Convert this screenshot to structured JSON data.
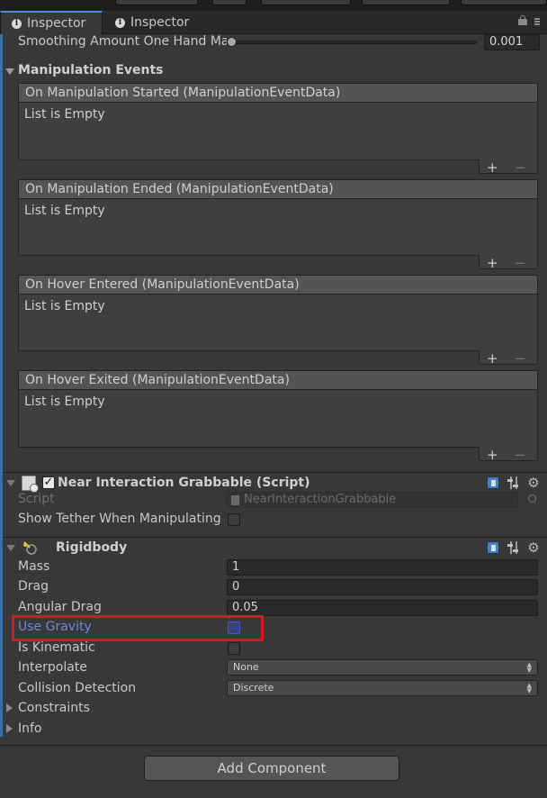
{
  "tabs": [
    {
      "label": "Inspector",
      "icon": "info-icon",
      "active": true
    },
    {
      "label": "Inspector",
      "icon": "info-icon",
      "active": false
    }
  ],
  "smoothing": {
    "label": "Smoothing Amount One Hand Ma",
    "value": "0.001",
    "slider_fraction": 0.001
  },
  "manipulation_events": {
    "title": "Manipulation Events",
    "events": [
      {
        "header": "On Manipulation Started (ManipulationEventData)",
        "body": "List is Empty"
      },
      {
        "header": "On Manipulation Ended (ManipulationEventData)",
        "body": "List is Empty"
      },
      {
        "header": "On Hover Entered (ManipulationEventData)",
        "body": "List is Empty"
      },
      {
        "header": "On Hover Exited (ManipulationEventData)",
        "body": "List is Empty"
      }
    ],
    "add_symbol": "+",
    "remove_symbol": "−"
  },
  "grabbable": {
    "title": "Near Interaction Grabbable (Script)",
    "enabled": true,
    "script_label": "Script",
    "script_value": "NearInteractionGrabbable",
    "tether_label": "Show Tether When Manipulating",
    "tether_checked": false
  },
  "rigidbody": {
    "title": "Rigidbody",
    "mass_label": "Mass",
    "mass_value": "1",
    "drag_label": "Drag",
    "drag_value": "0",
    "angular_drag_label": "Angular Drag",
    "angular_drag_value": "0.05",
    "use_gravity_label": "Use Gravity",
    "use_gravity_checked": false,
    "is_kinematic_label": "Is Kinematic",
    "is_kinematic_checked": false,
    "interpolate_label": "Interpolate",
    "interpolate_value": "None",
    "collision_label": "Collision Detection",
    "collision_value": "Discrete",
    "constraints_label": "Constraints",
    "info_label": "Info"
  },
  "add_component_label": "Add Component",
  "colors": {
    "accent": "#3a6fae",
    "highlight": "#e0141e",
    "use_gravity_text": "#6f86e0"
  }
}
